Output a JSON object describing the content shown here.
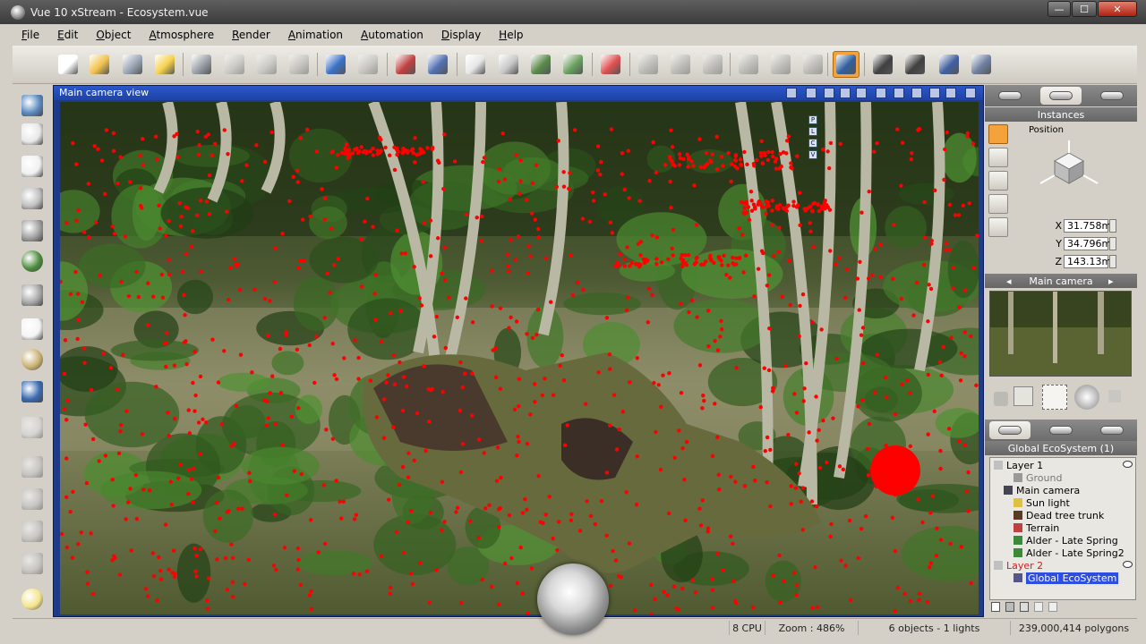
{
  "window": {
    "title": "Vue 10 xStream - Ecosystem.vue",
    "controls": {
      "minimize": "—",
      "maximize": "☐",
      "close": "✕"
    }
  },
  "menu": [
    "File",
    "Edit",
    "Object",
    "Atmosphere",
    "Render",
    "Animation",
    "Automation",
    "Display",
    "Help"
  ],
  "toolbar": {
    "icons": [
      "new-document-icon",
      "open-folder-icon",
      "save-icon",
      "save-lightning-icon",
      "scissors-icon",
      "copy-icon",
      "paste-icon",
      "duplicate-icon",
      "undo-icon",
      "redo-icon",
      "select-record-icon",
      "select-target-icon",
      "atmosphere-icon",
      "object-cube-icon",
      "material-brush-icon",
      "plant-editor-icon",
      "color-balls-icon",
      "render-sphere-icon",
      "align-icon",
      "mirror-icon",
      "zoom-icon",
      "zoom-in-icon",
      "zoom-out-icon",
      "camera-frame-icon",
      "filmstrip-icon",
      "clapper-icon",
      "fit-icon",
      "camera-icon"
    ],
    "active": "camera-frame-icon"
  },
  "left_tools": [
    "plane-icon",
    "cube-icon",
    "text-icon",
    "terrain-icon",
    "mountain-icon",
    "tree-icon",
    "rock-icon",
    "cloud-icon",
    "planet-icon",
    "curve-icon",
    "object-icon",
    "boolean-icon",
    "metablob-icon",
    "spline-icon",
    "group-icon",
    "light-bulb-icon"
  ],
  "viewport": {
    "title": "Main camera view",
    "corner_buttons": [
      "P",
      "L",
      "C",
      "V"
    ]
  },
  "right_panel": {
    "tab_title": "Instances",
    "position_label": "Position",
    "coords": [
      {
        "axis": "X",
        "value": "31.758m"
      },
      {
        "axis": "Y",
        "value": "34.796m"
      },
      {
        "axis": "Z",
        "value": "143.13m"
      }
    ],
    "camera_label": "Main camera",
    "ecosystem_label": "Global EcoSystem (1)",
    "tree": [
      {
        "label": "Layer 1",
        "indent": 0,
        "icon": "layer-icon",
        "selected": false
      },
      {
        "label": "Ground",
        "indent": 2,
        "icon": "ground-icon",
        "selected": false
      },
      {
        "label": "Main camera",
        "indent": 1,
        "icon": "camera-icon",
        "selected": false
      },
      {
        "label": "Sun light",
        "indent": 2,
        "icon": "sun-icon",
        "selected": false
      },
      {
        "label": "Dead tree trunk",
        "indent": 2,
        "icon": "trunk-icon",
        "selected": false
      },
      {
        "label": "Terrain",
        "indent": 2,
        "icon": "terrain-icon",
        "selected": false
      },
      {
        "label": "Alder - Late Spring",
        "indent": 2,
        "icon": "plant-icon",
        "selected": false
      },
      {
        "label": "Alder - Late Spring2",
        "indent": 2,
        "icon": "plant-icon",
        "selected": false
      },
      {
        "label": "Layer 2",
        "indent": 0,
        "icon": "layer-icon",
        "selected": true
      },
      {
        "label": "Global EcoSystem",
        "indent": 2,
        "icon": "ecosystem-icon",
        "selected": true
      }
    ]
  },
  "status": {
    "cpu": "8 CPU",
    "zoom": "Zoom : 486%",
    "objects": "6 objects - 1 lights",
    "polygons": "239,000,414 polygons"
  },
  "colors": {
    "viewport_frame": "#1d43a6",
    "selection": "#2d4ee0",
    "active_tool": "#f3a23c",
    "instance_points": "#ff0000"
  }
}
